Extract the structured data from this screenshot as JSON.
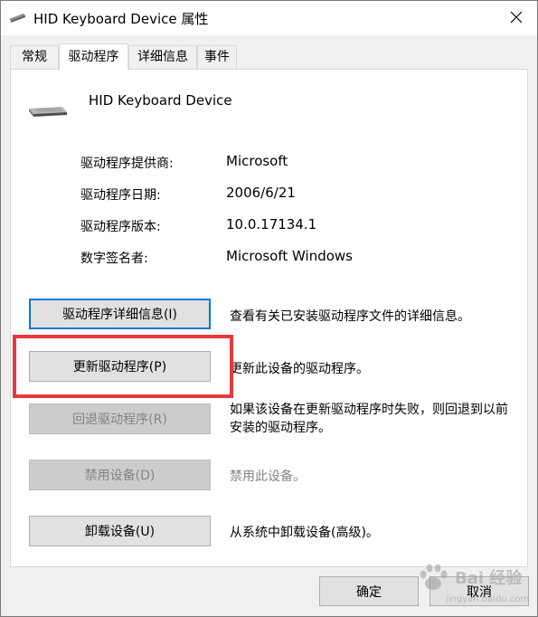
{
  "window": {
    "title": "HID Keyboard Device 属性",
    "close_icon": "close-icon"
  },
  "tabs": [
    {
      "label": "常规",
      "active": false
    },
    {
      "label": "驱动程序",
      "active": true
    },
    {
      "label": "详细信息",
      "active": false
    },
    {
      "label": "事件",
      "active": false
    }
  ],
  "device": {
    "name": "HID Keyboard Device",
    "icon": "keyboard-icon"
  },
  "properties": [
    {
      "label": "驱动程序提供商:",
      "value": "Microsoft"
    },
    {
      "label": "驱动程序日期:",
      "value": "2006/6/21"
    },
    {
      "label": "驱动程序版本:",
      "value": "10.0.17134.1"
    },
    {
      "label": "数字签名者:",
      "value": "Microsoft Windows"
    }
  ],
  "actions": [
    {
      "button": "驱动程序详细信息(I)",
      "description": "查看有关已安装驱动程序文件的详细信息。",
      "enabled": true
    },
    {
      "button": "更新驱动程序(P)",
      "description": "更新此设备的驱动程序。",
      "enabled": true
    },
    {
      "button": "回退驱动程序(R)",
      "description": "如果该设备在更新驱动程序时失败，则回退到以前安装的驱动程序。",
      "enabled": false
    },
    {
      "button": "禁用设备(D)",
      "description": "禁用此设备。",
      "enabled": false
    },
    {
      "button": "卸载设备(U)",
      "description": "从系统中卸载设备(高级)。",
      "enabled": true
    }
  ],
  "footer": {
    "ok_label": "确定",
    "cancel_label": "取消"
  },
  "colors": {
    "focus_border": "#0078d7",
    "highlight_annotation": "#e53a3a"
  },
  "watermark": {
    "text": "Bai 经验",
    "sub": "jingyan.baidu.com"
  }
}
